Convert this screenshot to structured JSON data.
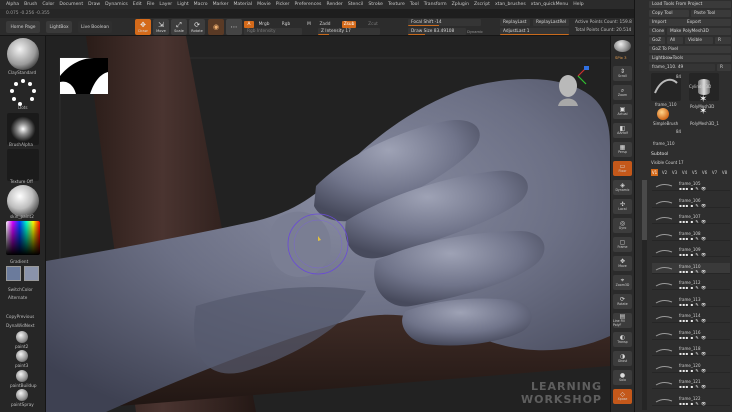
{
  "menu": [
    "Alpha",
    "Brush",
    "Color",
    "Document",
    "Draw",
    "Dynamics",
    "Edit",
    "File",
    "Layer",
    "Light",
    "Macro",
    "Marker",
    "Material",
    "Movie",
    "Picker",
    "Preferences",
    "Render",
    "Stencil",
    "Stroke",
    "Texture",
    "Tool",
    "Transform",
    "Zplugin",
    "Zscript",
    "xtan_brushes",
    "xtan_quickMenu",
    "Help"
  ],
  "info_text": "0.075 -0.256 -0.355",
  "shelf": {
    "home_page": "Home Page",
    "lightbox": "LightBox",
    "live_boolean": "Live Boolean",
    "draw": "Draw",
    "move": "Move",
    "scale": "Scale",
    "rotate": "Rotate",
    "a_toggle": "A",
    "mrgb": "Mrgb",
    "rgb": "Rgb",
    "m": "M",
    "zadd": "Zadd",
    "zsub": "Zsub",
    "zcut": "Zcut",
    "rgb_intensity": "Rgb Intensity",
    "z_intensity": "Z Intensity 17",
    "focal_shift": "Focal Shift -14",
    "draw_size": "Draw Size 83.49108",
    "dynamic": "Dynamic",
    "replay_last": "ReplayLast",
    "replay_last_rel": "ReplayLastRel",
    "adjust_last": "AdjustLast 1",
    "active_points": "Active Points Count: 159.8",
    "total_points": "Total Points Count: 20.514"
  },
  "left": {
    "brush_name": "ClaySBuildup",
    "brush_label": "ClayStandard",
    "stroke_label": "Dots",
    "alpha_label": "BrushAlpha",
    "texture_label": "Texture Off",
    "material_label": "skin_paint2",
    "gradient_label": "Gradient",
    "switch_color": "SwitchColor",
    "alternate": "Alternate",
    "copy_previous": "CopyPrevious",
    "dynamesh_label": "DynaWidNext",
    "paints": [
      "paint2",
      "paint3",
      "paintBuildup",
      "paintSpray"
    ]
  },
  "right": {
    "spix": "SPix 3",
    "buttons": [
      "Scroll",
      "Zoom",
      "Actual",
      "AAHalf",
      "Persp",
      "Floor",
      "Dynamic",
      "Local",
      "Gyro",
      "Frame",
      "Move",
      "Zoom3D",
      "Rotate",
      "Line Fill PolyF",
      "Transp",
      "Ghost",
      "Solo",
      "Xpose"
    ],
    "active_indices": [
      5,
      17
    ]
  },
  "palette": {
    "load_tools": "Load Tools From Project",
    "copy_tool": "Copy Tool",
    "paste_tool": "Paste Tool",
    "import": "Import",
    "export": "Export",
    "clone": "Clone",
    "make_polymesh": "Make PolyMesh3D",
    "goz": "GoZ",
    "all": "All",
    "visible": "Visible",
    "r": "R",
    "goz_to_pixel": "GoZ To Pixel",
    "lightbox_tools": "Lightbox▸Tools",
    "tool_name": "frame_110. 49",
    "r2": "R",
    "tiles": [
      {
        "name": "frame_110",
        "count": "84"
      },
      {
        "name": "Cylinder3D",
        "count": ""
      },
      {
        "name": "PolyMesh3D",
        "count": ""
      },
      {
        "name": "SimpleBrush",
        "count": ""
      },
      {
        "name": "PolyMesh3D_1",
        "count": ""
      },
      {
        "name": "frame_110",
        "count": "84"
      }
    ],
    "subtool_title": "Subtool",
    "visible_count": "Visible Count 17",
    "vtabs": [
      "V1",
      "V2",
      "V3",
      "V4",
      "V5",
      "V6",
      "V7",
      "V8"
    ],
    "subtools": [
      "frame_105",
      "frame_106",
      "frame_107",
      "frame_108",
      "frame_109",
      "frame_110",
      "frame_112",
      "frame_113",
      "frame_114",
      "frame_116",
      "frame_118",
      "frame_120",
      "frame_121",
      "frame_122"
    ]
  },
  "watermark": {
    "line1": "LEARNING",
    "line2": "WORKSHOP"
  },
  "colors": {
    "accent": "#d46a1a",
    "skin": "#6b6f84",
    "shaft": "#3e2b26"
  }
}
